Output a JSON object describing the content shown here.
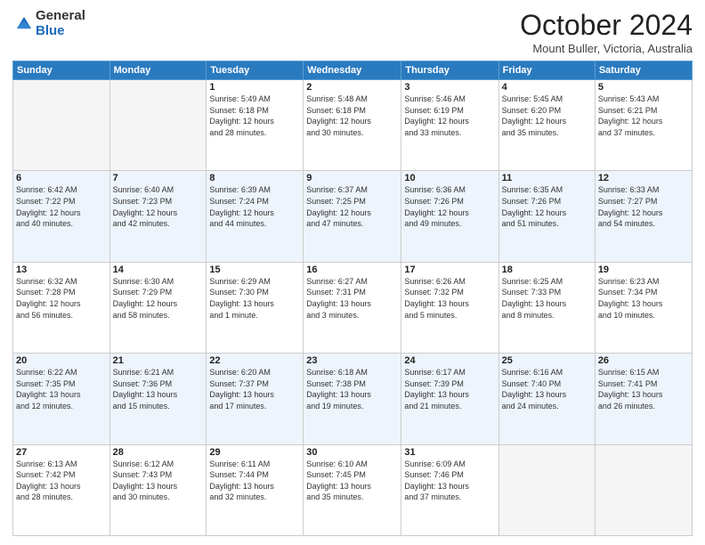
{
  "logo": {
    "general": "General",
    "blue": "Blue"
  },
  "header": {
    "month": "October 2024",
    "location": "Mount Buller, Victoria, Australia"
  },
  "days_of_week": [
    "Sunday",
    "Monday",
    "Tuesday",
    "Wednesday",
    "Thursday",
    "Friday",
    "Saturday"
  ],
  "weeks": [
    [
      {
        "day": "",
        "info": ""
      },
      {
        "day": "",
        "info": ""
      },
      {
        "day": "1",
        "info": "Sunrise: 5:49 AM\nSunset: 6:18 PM\nDaylight: 12 hours\nand 28 minutes."
      },
      {
        "day": "2",
        "info": "Sunrise: 5:48 AM\nSunset: 6:18 PM\nDaylight: 12 hours\nand 30 minutes."
      },
      {
        "day": "3",
        "info": "Sunrise: 5:46 AM\nSunset: 6:19 PM\nDaylight: 12 hours\nand 33 minutes."
      },
      {
        "day": "4",
        "info": "Sunrise: 5:45 AM\nSunset: 6:20 PM\nDaylight: 12 hours\nand 35 minutes."
      },
      {
        "day": "5",
        "info": "Sunrise: 5:43 AM\nSunset: 6:21 PM\nDaylight: 12 hours\nand 37 minutes."
      }
    ],
    [
      {
        "day": "6",
        "info": "Sunrise: 6:42 AM\nSunset: 7:22 PM\nDaylight: 12 hours\nand 40 minutes."
      },
      {
        "day": "7",
        "info": "Sunrise: 6:40 AM\nSunset: 7:23 PM\nDaylight: 12 hours\nand 42 minutes."
      },
      {
        "day": "8",
        "info": "Sunrise: 6:39 AM\nSunset: 7:24 PM\nDaylight: 12 hours\nand 44 minutes."
      },
      {
        "day": "9",
        "info": "Sunrise: 6:37 AM\nSunset: 7:25 PM\nDaylight: 12 hours\nand 47 minutes."
      },
      {
        "day": "10",
        "info": "Sunrise: 6:36 AM\nSunset: 7:26 PM\nDaylight: 12 hours\nand 49 minutes."
      },
      {
        "day": "11",
        "info": "Sunrise: 6:35 AM\nSunset: 7:26 PM\nDaylight: 12 hours\nand 51 minutes."
      },
      {
        "day": "12",
        "info": "Sunrise: 6:33 AM\nSunset: 7:27 PM\nDaylight: 12 hours\nand 54 minutes."
      }
    ],
    [
      {
        "day": "13",
        "info": "Sunrise: 6:32 AM\nSunset: 7:28 PM\nDaylight: 12 hours\nand 56 minutes."
      },
      {
        "day": "14",
        "info": "Sunrise: 6:30 AM\nSunset: 7:29 PM\nDaylight: 12 hours\nand 58 minutes."
      },
      {
        "day": "15",
        "info": "Sunrise: 6:29 AM\nSunset: 7:30 PM\nDaylight: 13 hours\nand 1 minute."
      },
      {
        "day": "16",
        "info": "Sunrise: 6:27 AM\nSunset: 7:31 PM\nDaylight: 13 hours\nand 3 minutes."
      },
      {
        "day": "17",
        "info": "Sunrise: 6:26 AM\nSunset: 7:32 PM\nDaylight: 13 hours\nand 5 minutes."
      },
      {
        "day": "18",
        "info": "Sunrise: 6:25 AM\nSunset: 7:33 PM\nDaylight: 13 hours\nand 8 minutes."
      },
      {
        "day": "19",
        "info": "Sunrise: 6:23 AM\nSunset: 7:34 PM\nDaylight: 13 hours\nand 10 minutes."
      }
    ],
    [
      {
        "day": "20",
        "info": "Sunrise: 6:22 AM\nSunset: 7:35 PM\nDaylight: 13 hours\nand 12 minutes."
      },
      {
        "day": "21",
        "info": "Sunrise: 6:21 AM\nSunset: 7:36 PM\nDaylight: 13 hours\nand 15 minutes."
      },
      {
        "day": "22",
        "info": "Sunrise: 6:20 AM\nSunset: 7:37 PM\nDaylight: 13 hours\nand 17 minutes."
      },
      {
        "day": "23",
        "info": "Sunrise: 6:18 AM\nSunset: 7:38 PM\nDaylight: 13 hours\nand 19 minutes."
      },
      {
        "day": "24",
        "info": "Sunrise: 6:17 AM\nSunset: 7:39 PM\nDaylight: 13 hours\nand 21 minutes."
      },
      {
        "day": "25",
        "info": "Sunrise: 6:16 AM\nSunset: 7:40 PM\nDaylight: 13 hours\nand 24 minutes."
      },
      {
        "day": "26",
        "info": "Sunrise: 6:15 AM\nSunset: 7:41 PM\nDaylight: 13 hours\nand 26 minutes."
      }
    ],
    [
      {
        "day": "27",
        "info": "Sunrise: 6:13 AM\nSunset: 7:42 PM\nDaylight: 13 hours\nand 28 minutes."
      },
      {
        "day": "28",
        "info": "Sunrise: 6:12 AM\nSunset: 7:43 PM\nDaylight: 13 hours\nand 30 minutes."
      },
      {
        "day": "29",
        "info": "Sunrise: 6:11 AM\nSunset: 7:44 PM\nDaylight: 13 hours\nand 32 minutes."
      },
      {
        "day": "30",
        "info": "Sunrise: 6:10 AM\nSunset: 7:45 PM\nDaylight: 13 hours\nand 35 minutes."
      },
      {
        "day": "31",
        "info": "Sunrise: 6:09 AM\nSunset: 7:46 PM\nDaylight: 13 hours\nand 37 minutes."
      },
      {
        "day": "",
        "info": ""
      },
      {
        "day": "",
        "info": ""
      }
    ]
  ]
}
